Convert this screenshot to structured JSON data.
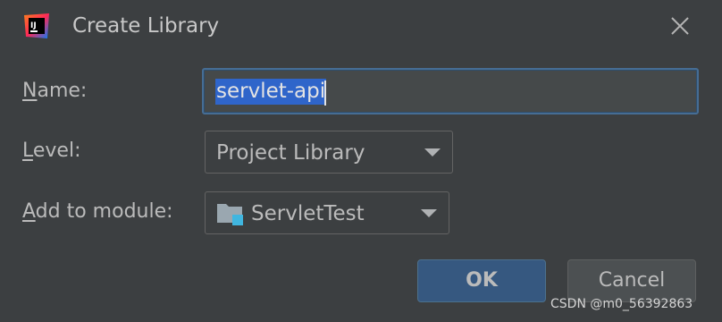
{
  "dialog": {
    "title": "Create Library",
    "app_icon": "intellij-idea-icon",
    "close_icon": "close-icon"
  },
  "form": {
    "name_label_mnemonic": "N",
    "name_label_rest": "ame:",
    "name_value": "servlet-api",
    "level_label_mnemonic": "L",
    "level_label_rest": "evel:",
    "level_value": "Project Library",
    "module_label_mnemonic": "A",
    "module_label_rest": "dd to module:",
    "module_value": "ServletTest",
    "module_icon": "folder-module-icon"
  },
  "buttons": {
    "ok_label": "OK",
    "cancel_label": "Cancel"
  },
  "watermark": "CSDN @m0_56392863",
  "colors": {
    "background": "#3c3f41",
    "accent": "#365880",
    "selection": "#2f65ca",
    "focus_border": "#466d94"
  }
}
